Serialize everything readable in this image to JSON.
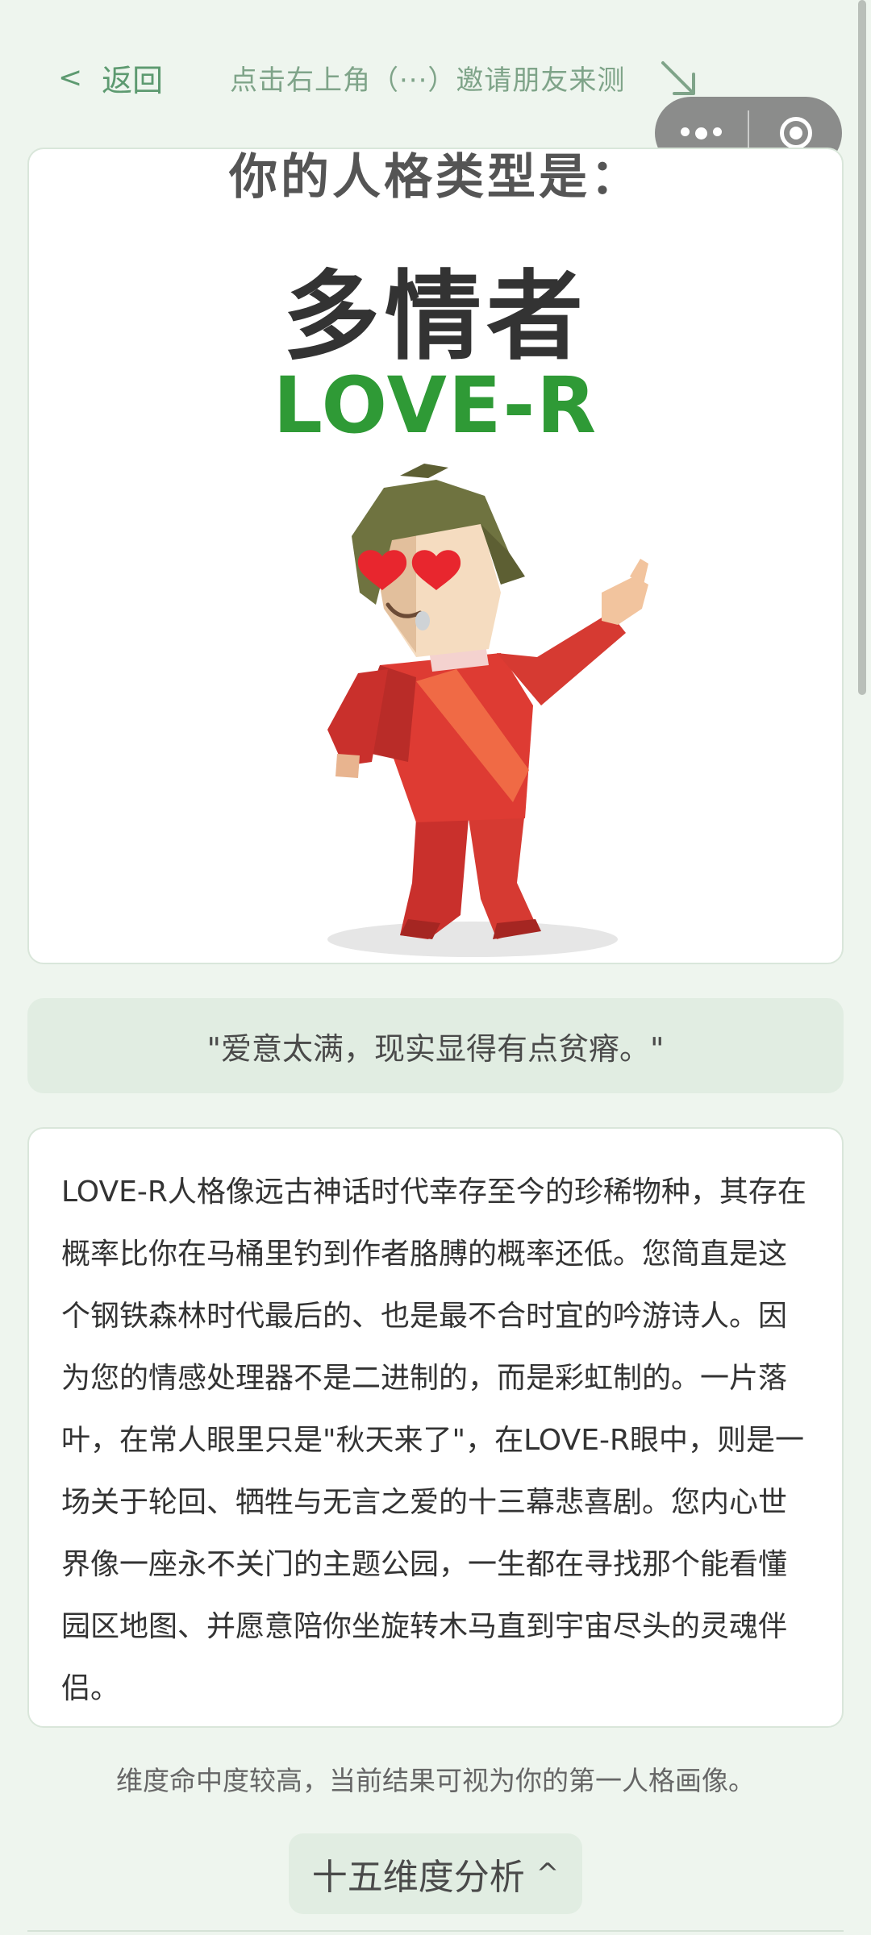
{
  "header": {
    "back_label": "返回",
    "back_icon": "chevron-left-icon",
    "invite_hint": "点击右上角（···）邀请朋友来测",
    "invite_arrow_icon": "arrow-down-right-icon"
  },
  "capsule": {
    "more_icon": "more-dots-icon",
    "close_icon": "close-miniprogram-icon"
  },
  "result": {
    "heading": "你的人格类型是：",
    "type_name": "多情者",
    "type_code": "LOVE-R",
    "illustration": "red-suit-man-heart-eyes"
  },
  "quote": "\"爱意太满，现实显得有点贫瘠。\"",
  "description": "LOVE-R人格像远古神话时代幸存至今的珍稀物种，其存在概率比你在马桶里钓到作者胳膊的概率还低。您简直是这个钢铁森林时代最后的、也是最不合时宜的吟游诗人。因为您的情感处理器不是二进制的，而是彩虹制的。一片落叶，在常人眼里只是\"秋天来了\"，在LOVE-R眼中，则是一场关于轮回、牺牲与无言之爱的十三幕悲喜剧。您内心世界像一座永不关门的主题公园，一生都在寻找那个能看懂园区地图、并愿意陪你坐旋转木马直到宇宙尽头的灵魂伴侣。",
  "note": "维度命中度较高，当前结果可视为你的第一人格画像。",
  "analysis_button": {
    "label": "十五维度分析",
    "caret": "^"
  },
  "colors": {
    "background": "#eef5ee",
    "accent_green": "#2f9a36",
    "soft_green": "#e1ede2",
    "link_green": "#5d9a70"
  }
}
